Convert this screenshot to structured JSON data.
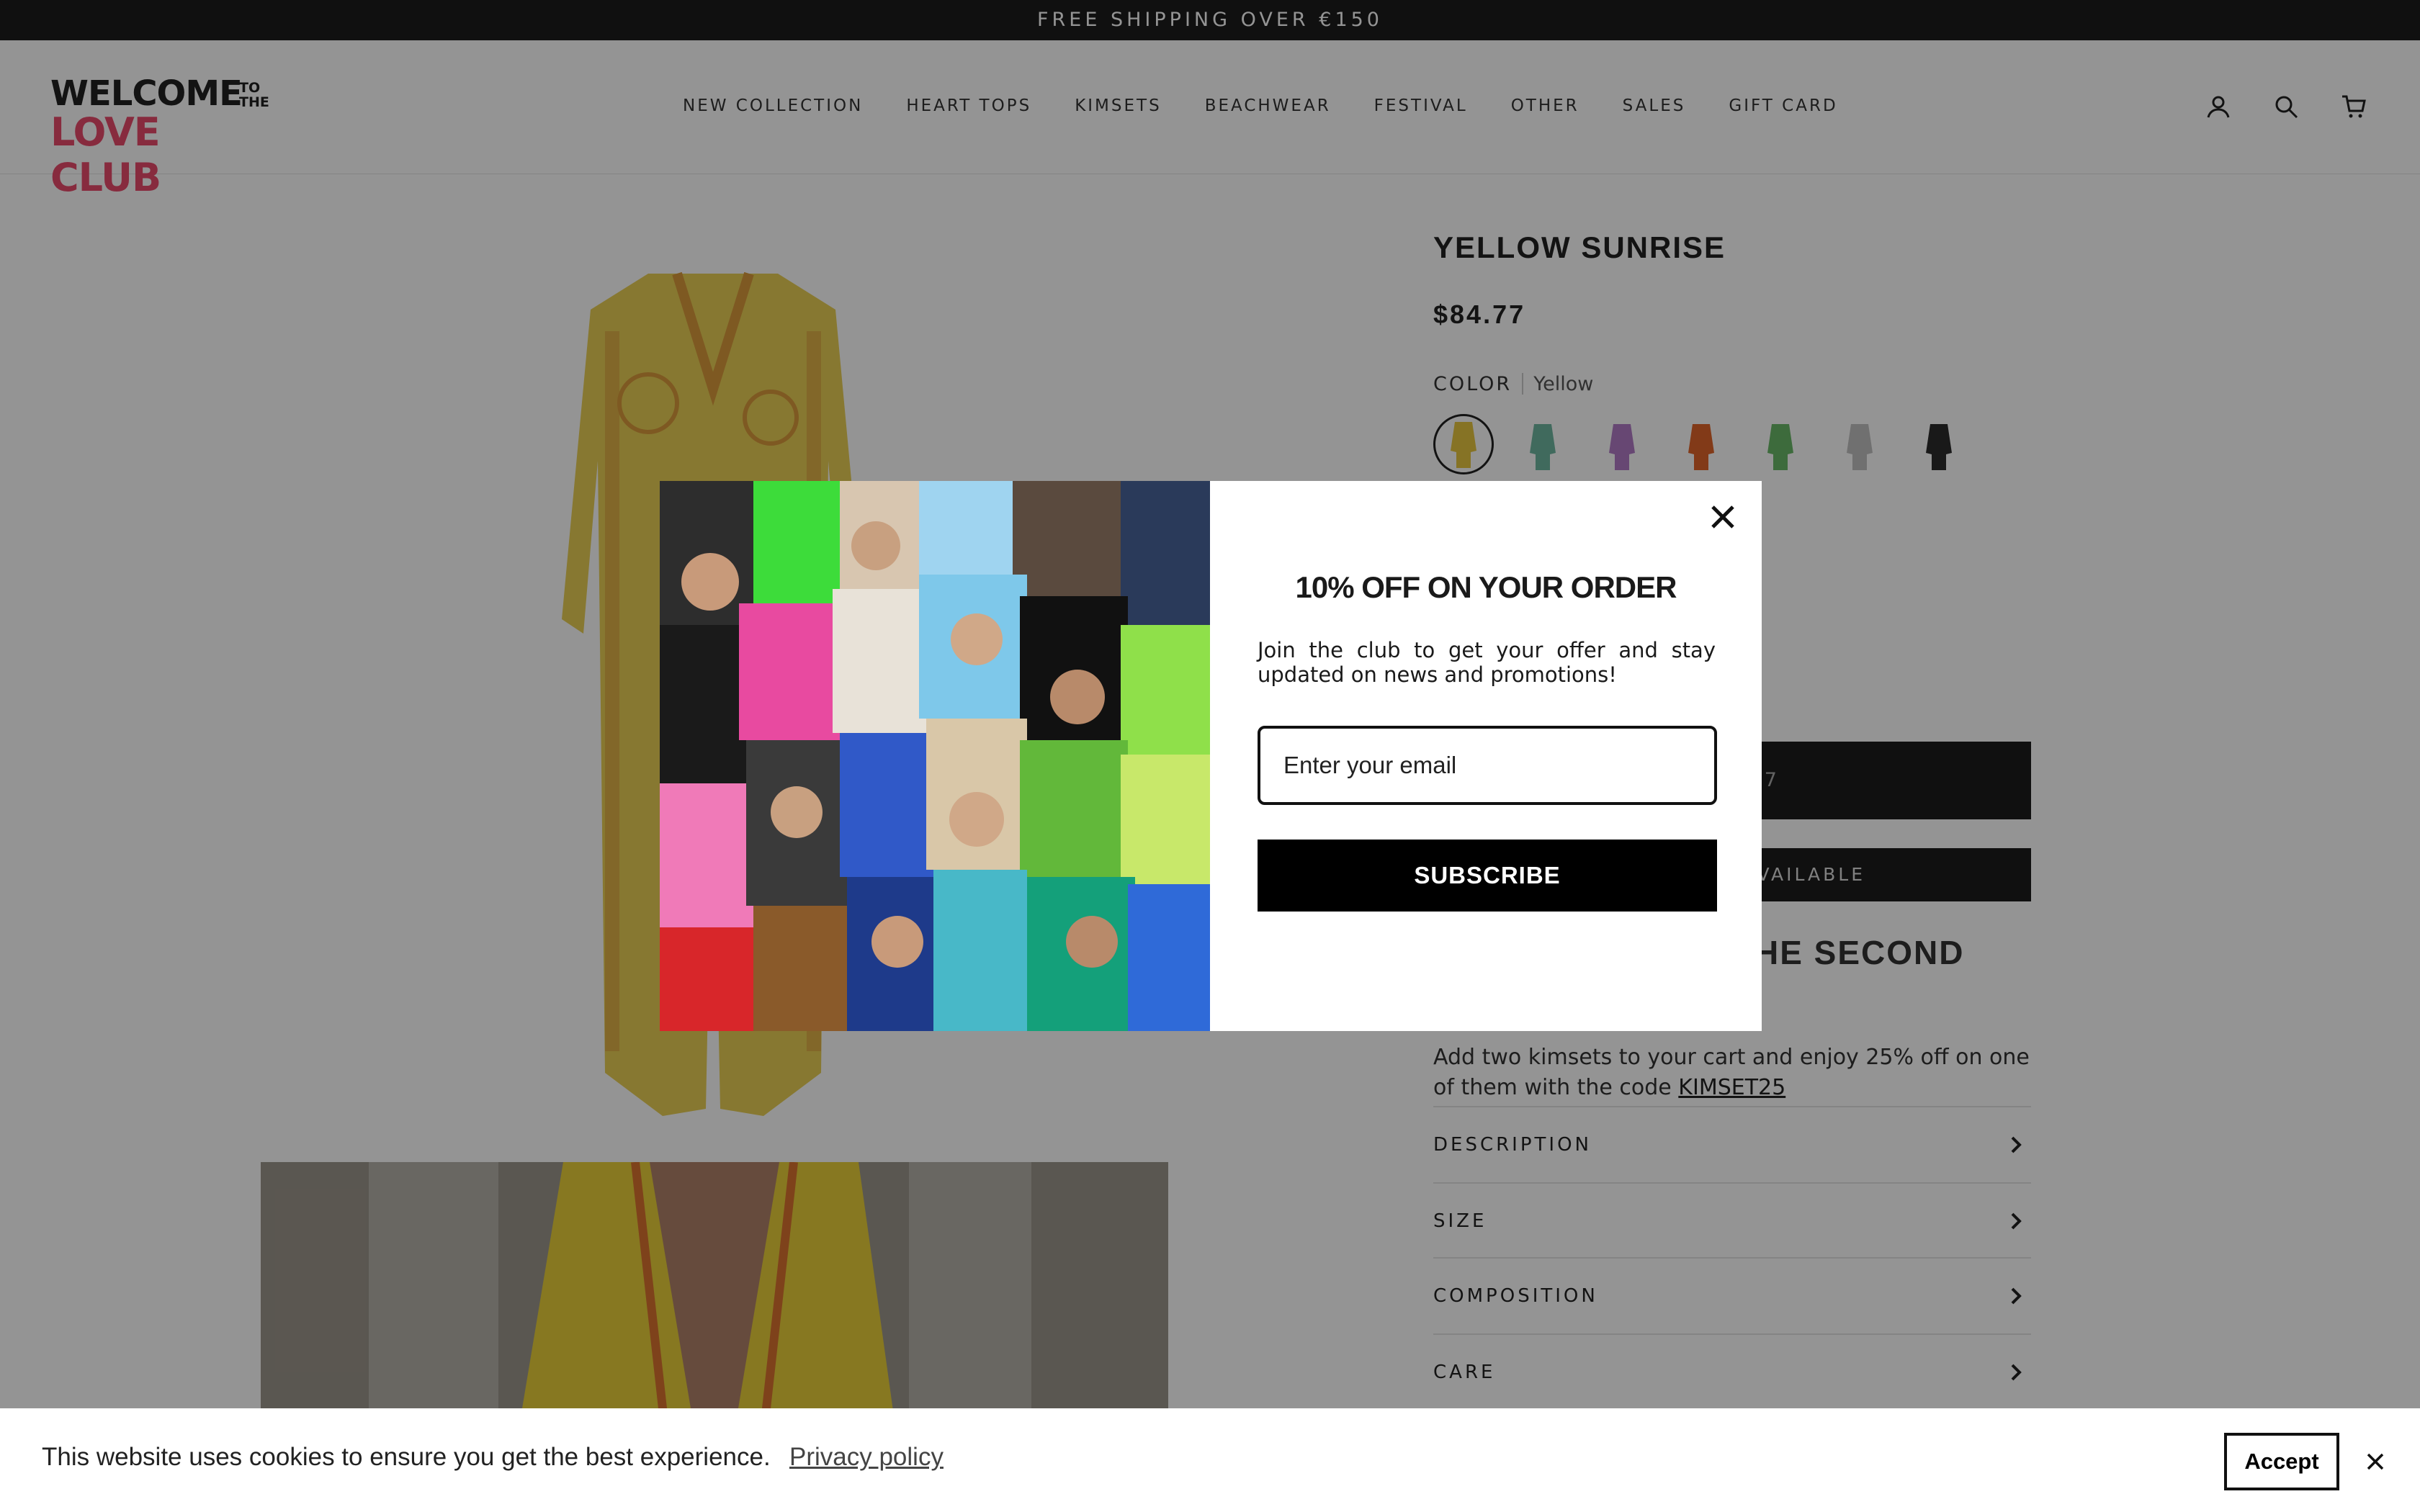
{
  "announcement": "FREE SHIPPING OVER €150",
  "logo": {
    "line1": "WELCOME",
    "line2": "LOVE CLUB",
    "tothe": "TO THE"
  },
  "nav": [
    "NEW COLLECTION",
    "HEART TOPS",
    "KIMSETS",
    "BEACHWEAR",
    "FESTIVAL",
    "OTHER",
    "SALES",
    "GIFT CARD"
  ],
  "header_icons": [
    "account-icon",
    "search-icon",
    "cart-icon"
  ],
  "product": {
    "title": "YELLOW SUNRISE",
    "price": "$84.77",
    "color_label": "COLOR",
    "color_value": "Yellow",
    "swatch_colors": [
      "#e7c640",
      "#6fb7a0",
      "#b27bc7",
      "#e0652a",
      "#6ab868",
      "#c2c2c2",
      "#2b2b2b"
    ],
    "add_button": "$84.77",
    "notify_button": "AVAILABLE",
    "promo_heading": "HE SECOND",
    "promo_text": "Add two kimsets to your cart and enjoy 25% off on one of them with the code ",
    "promo_code": "KIMSET25",
    "accordion": [
      "DESCRIPTION",
      "SIZE",
      "COMPOSITION",
      "CARE"
    ]
  },
  "popup": {
    "title": "10% OFF ON YOUR ORDER",
    "text": "Join the club to get your offer and stay updated on news and promotions!",
    "email_placeholder": "Enter your email",
    "button": "SUBSCRIBE"
  },
  "cookie": {
    "message": "This website uses cookies to ensure you get the best experience.",
    "link": "Privacy policy",
    "accept": "Accept"
  },
  "colors": {
    "accent": "#e84a6c",
    "dark": "#1d1d1d",
    "kimono": "#e8cf55",
    "kimono_trim": "#d99a3c"
  }
}
